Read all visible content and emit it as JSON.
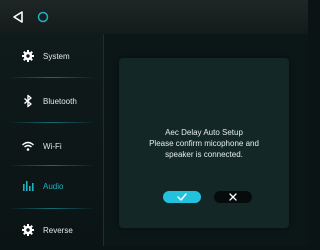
{
  "topbar": {
    "back_icon": "back-triangle-icon",
    "home_icon": "home-circle-icon"
  },
  "sidebar": {
    "items": [
      {
        "label": "System",
        "icon": "gear-icon",
        "active": false
      },
      {
        "label": "Bluetooth",
        "icon": "bluetooth-icon",
        "active": false
      },
      {
        "label": "Wi-Fi",
        "icon": "wifi-icon",
        "active": false
      },
      {
        "label": "Audio",
        "icon": "equalizer-icon",
        "active": true
      },
      {
        "label": "Reverse",
        "icon": "gear-icon",
        "active": false
      }
    ]
  },
  "dialog": {
    "line1": "Aec Delay Auto Setup",
    "line2": "Please confirm micophone and",
    "line3": "speaker is connected.",
    "confirm_icon": "check-icon",
    "cancel_icon": "close-icon"
  },
  "colors": {
    "accent": "#1fb1c2",
    "confirm_button": "#22c2dd",
    "cancel_button": "#060b0b",
    "dialog_bg": "#142727",
    "background": "#0a1414"
  }
}
